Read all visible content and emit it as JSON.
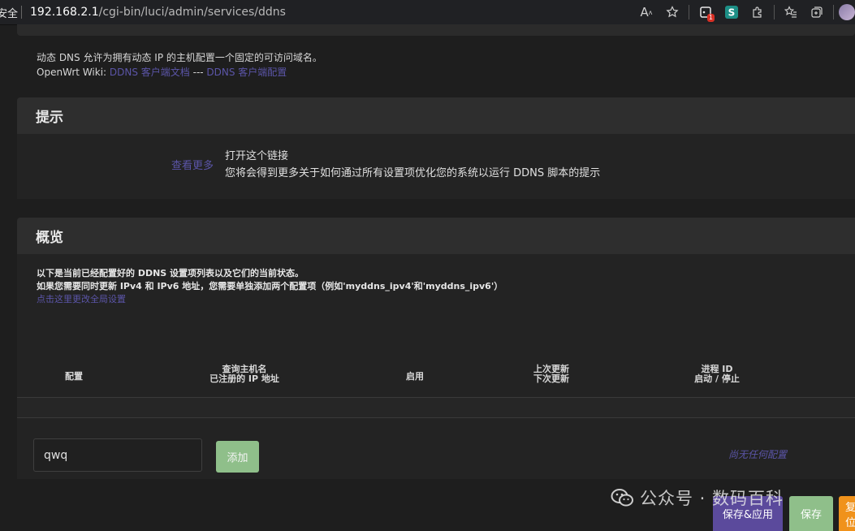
{
  "browser": {
    "security_label": "不安全",
    "url_host": "192.168.2.1",
    "url_path": "/cgi-bin/luci/admin/services/ddns",
    "extension_badge": "1"
  },
  "intro": {
    "line1": "动态 DNS 允许为拥有动态 IP 的主机配置一个固定的可访问域名。",
    "wiki_prefix": "OpenWrt Wiki: ",
    "wiki_link_docs": "DDNS 客户端文档",
    "separator": " --- ",
    "wiki_link_config": "DDNS 客户端配置"
  },
  "tips": {
    "title": "提示",
    "more_link": "查看更多",
    "line1": "打开这个链接",
    "line2": "您将会得到更多关于如何通过所有设置项优化您的系统以运行 DDNS 脚本的提示"
  },
  "overview": {
    "title": "概览",
    "desc1": "以下是当前已经配置好的 DDNS 设置项列表以及它们的当前状态。",
    "desc2": "如果您需要同时更新 IPv4 和 IPv6 地址，您需要单独添加两个配置项（例如'myddns_ipv4'和'myddns_ipv6'）",
    "global_link": "点击这里更改全局设置",
    "columns": [
      {
        "line1": "配置",
        "line2": ""
      },
      {
        "line1": "查询主机名",
        "line2": "已注册的 IP 地址"
      },
      {
        "line1": "启用",
        "line2": ""
      },
      {
        "line1": "上次更新",
        "line2": "下次更新"
      },
      {
        "line1": "进程 ID",
        "line2": "启动 / 停止"
      }
    ],
    "empty_note": "尚无任何配置",
    "new_name_value": "qwq",
    "add_label": "添加"
  },
  "actions": {
    "save_apply": "保存&应用",
    "save": "保存",
    "reset": "复位"
  },
  "watermark": {
    "text": "公众号 · 数码百科"
  },
  "colors": {
    "link": "#5b55a8",
    "green_button": "#8fbf8a",
    "purple_button": "#5b4a9c",
    "orange_button": "#f0921b"
  }
}
